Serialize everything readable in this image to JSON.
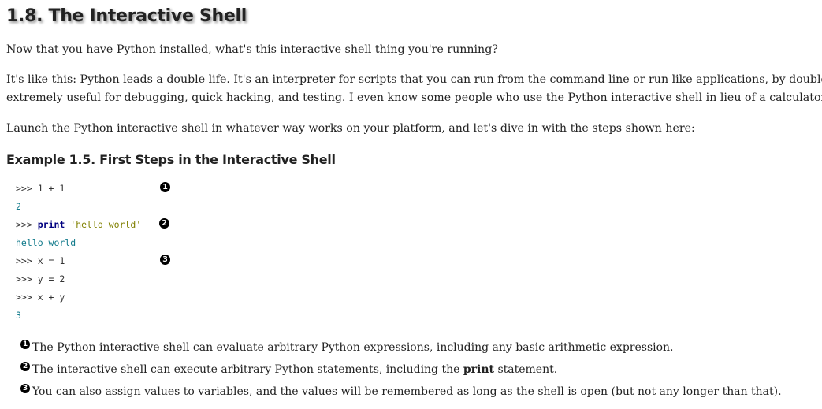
{
  "section": {
    "title": "1.8. The Interactive Shell"
  },
  "paragraphs": [
    "Now that you have Python installed, what's this interactive shell thing you're running?",
    "It's like this: Python leads a double life. It's an interpreter for scripts that you can run from the command line or run like applications, by double-cli",
    "extremely useful for debugging, quick hacking, and testing. I even know some people who use the Python interactive shell in lieu of a calculator!",
    "Launch the Python interactive shell in whatever way works on your platform, and let's dive in with the steps shown here:"
  ],
  "example": {
    "title": "Example 1.5. First Steps in the Interactive Shell",
    "lines": [
      {
        "prompt": ">>> ",
        "code": "1 + 1",
        "callout": "1"
      },
      {
        "output": "2"
      },
      {
        "prompt": ">>> ",
        "keyword": "print",
        "string": "'hello world'",
        "callout": "2"
      },
      {
        "output": "hello world"
      },
      {
        "prompt": ">>> ",
        "code": "x = 1",
        "callout": "3"
      },
      {
        "prompt": ">>> ",
        "code": "y = 2"
      },
      {
        "prompt": ">>> ",
        "code": "x + y"
      },
      {
        "output": "3"
      }
    ]
  },
  "notes": [
    {
      "callout": "1",
      "text": "The Python interactive shell can evaluate arbitrary Python expressions, including any basic arithmetic expression."
    },
    {
      "callout": "2",
      "text_before": "The interactive shell can execute arbitrary Python statements, including the ",
      "bold": "print",
      "text_after": " statement."
    },
    {
      "callout": "3",
      "text": "You can also assign values to variables, and the values will be remembered as long as the shell is open (but not any longer than that)."
    }
  ],
  "colors": {
    "keyword": "#000080",
    "string": "#808000",
    "output": "#117a8b",
    "text": "#222222"
  }
}
